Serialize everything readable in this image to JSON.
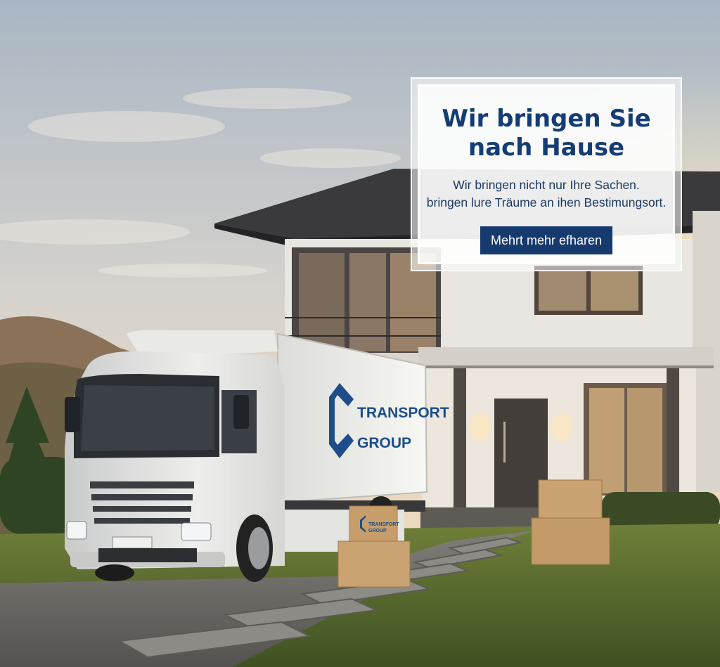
{
  "hero": {
    "headline_line1": "Wir bringen Sie",
    "headline_line2": "nach Hause",
    "subtext_line1": "Wir bringen nicht nur Ihre Sachen.",
    "subtext_line2": "bringen lure Träume an ihen Bestimungsort.",
    "cta_label": "Mehrt mehr efharen"
  },
  "truck": {
    "logo_line1": "TRANSPORT",
    "logo_line2": "GROUP"
  },
  "boxes": {
    "label_line1": "TRANSPORT",
    "label_line2": "GROUP"
  },
  "colors": {
    "brand_blue": "#163a6e",
    "headline_blue": "#143d75"
  }
}
